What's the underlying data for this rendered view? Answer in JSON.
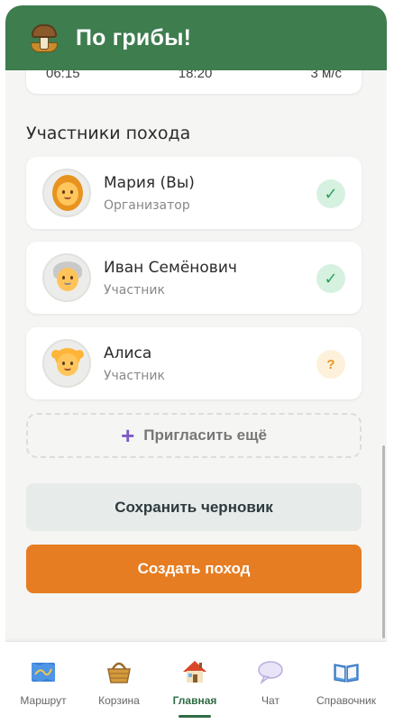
{
  "header": {
    "title": "По грибы!",
    "logo_icon": "mushroom-basket-icon"
  },
  "weather": {
    "values": [
      "06:15",
      "18:20",
      "3 м/с"
    ]
  },
  "participants": {
    "title": "Участники похода",
    "members": [
      {
        "name": "Мария (Вы)",
        "role": "Организатор",
        "status": "confirmed",
        "status_symbol": "✓",
        "avatar_icon": "woman-avatar-icon"
      },
      {
        "name": "Иван Семёнович",
        "role": "Участник",
        "status": "confirmed",
        "status_symbol": "✓",
        "avatar_icon": "old-man-avatar-icon"
      },
      {
        "name": "Алиса",
        "role": "Участник",
        "status": "pending",
        "status_symbol": "?",
        "avatar_icon": "girl-avatar-icon"
      }
    ],
    "invite_label": "Пригласить ещё",
    "invite_symbol": "+"
  },
  "actions": {
    "save_draft_label": "Сохранить черновик",
    "create_label": "Создать поход"
  },
  "tabbar": {
    "active": "Главная",
    "items": [
      {
        "label": "Маршрут",
        "icon": "map-icon"
      },
      {
        "label": "Корзина",
        "icon": "basket-icon"
      },
      {
        "label": "Главная",
        "icon": "home-icon"
      },
      {
        "label": "Чат",
        "icon": "chat-icon"
      },
      {
        "label": "Справочник",
        "icon": "book-icon"
      }
    ]
  },
  "colors": {
    "header": "#3e7d4e",
    "accent": "#e67d22",
    "active_tab": "#2f6b43",
    "confirmed": "#2ea05a",
    "pending": "#e8961e"
  }
}
